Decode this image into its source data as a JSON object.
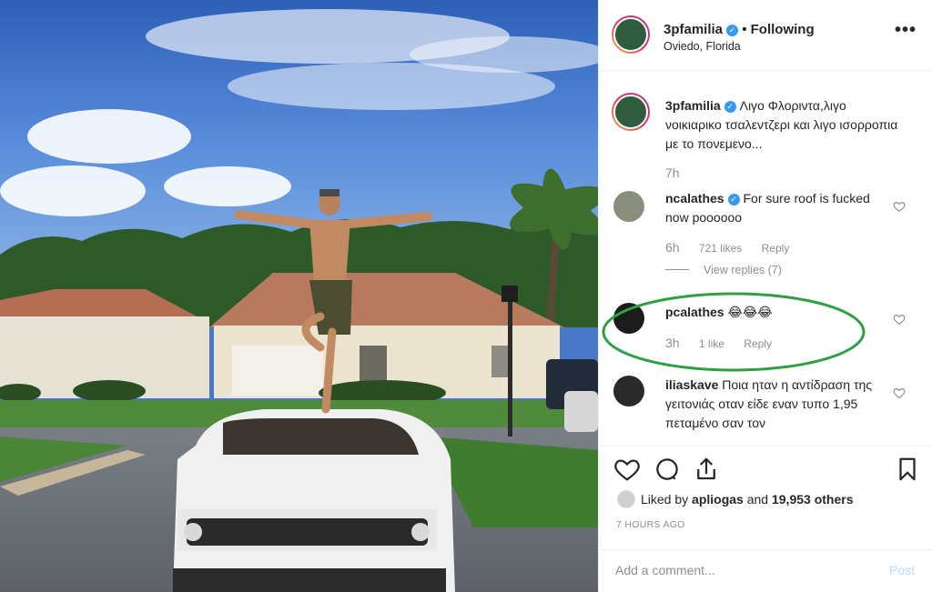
{
  "header": {
    "username": "3pfamilia",
    "follow_label": "• Following",
    "location": "Oviedo, Florida",
    "more_label": "•••"
  },
  "caption": {
    "username": "3pfamilia",
    "text": "Λιγο Φλοριντα,λιγο νοικιαρικο τσαλεντζερι και λιγο ισορροπια με το πονεμενο...",
    "time": "7h"
  },
  "comments": [
    {
      "username": "ncalathes",
      "verified": true,
      "text": "For sure roof is fucked now poooooo",
      "time": "6h",
      "likes": "721 likes",
      "reply": "Reply",
      "view_replies": "View replies (7)"
    },
    {
      "username": "pcalathes",
      "verified": false,
      "text": "😂😂😂",
      "time": "3h",
      "likes": "1 like",
      "reply": "Reply"
    },
    {
      "username": "iliaskave",
      "verified": false,
      "text": "Ποια ηταν η αντίδραση της γειτονιάς οταν είδε εναν τυπο 1,95 πεταμένο σαν τον"
    }
  ],
  "likes": {
    "prefix": "Liked by ",
    "user": "apliogas",
    "middle": " and ",
    "count": "19,953 others"
  },
  "timestamp": "7 HOURS AGO",
  "add_comment": {
    "placeholder": "Add a comment...",
    "post_label": "Post"
  },
  "colors": {
    "verified": "#3897f0",
    "highlight": "#2ea043",
    "post_button": "#b2dffc",
    "muted_text": "#8e8e8e"
  },
  "icons": [
    "heart-icon",
    "comment-icon",
    "share-icon",
    "bookmark-icon",
    "verified-badge-icon",
    "more-options-icon"
  ]
}
